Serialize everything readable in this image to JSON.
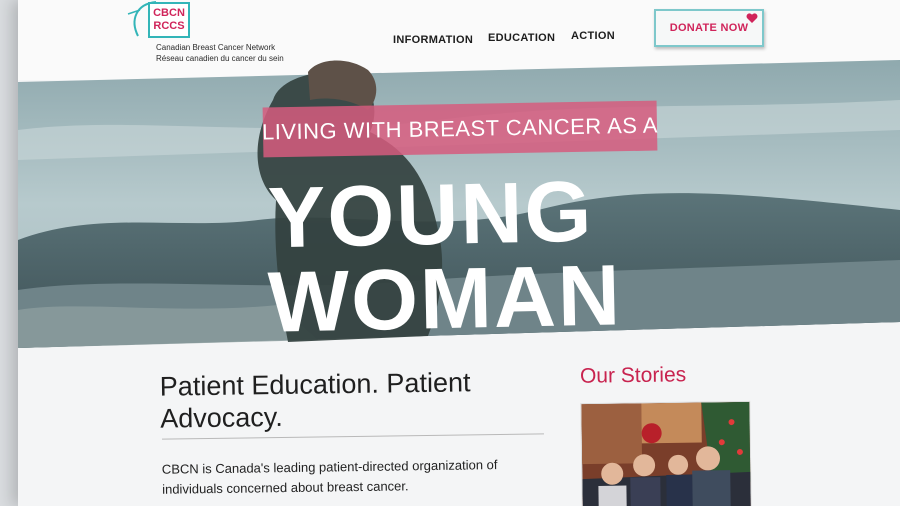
{
  "logo": {
    "line1": "CBCN",
    "line2": "RCCS",
    "name_en": "Canadian Breast Cancer Network",
    "name_fr": "Réseau  canadien du cancer du sein"
  },
  "nav": {
    "items": [
      "INFORMATION",
      "EDUCATION",
      "ACTION"
    ]
  },
  "donate": {
    "label": "DONATE NOW"
  },
  "hero": {
    "banner": "LIVING WITH BREAST CANCER AS A",
    "line1": "YOUNG",
    "line2": "WOMAN"
  },
  "main": {
    "headline_1": "Patient Education. Patient",
    "headline_2": "Advocacy.",
    "description_1": "CBCN is Canada's leading patient-directed organization of",
    "description_2": "individuals concerned about breast cancer."
  },
  "stories": {
    "title": "Our Stories"
  },
  "colors": {
    "brand_pink": "#d0245a",
    "brand_teal": "#33b5b8",
    "banner_pink": "#d65c7e"
  },
  "icons": {
    "donate": "heart-icon"
  }
}
